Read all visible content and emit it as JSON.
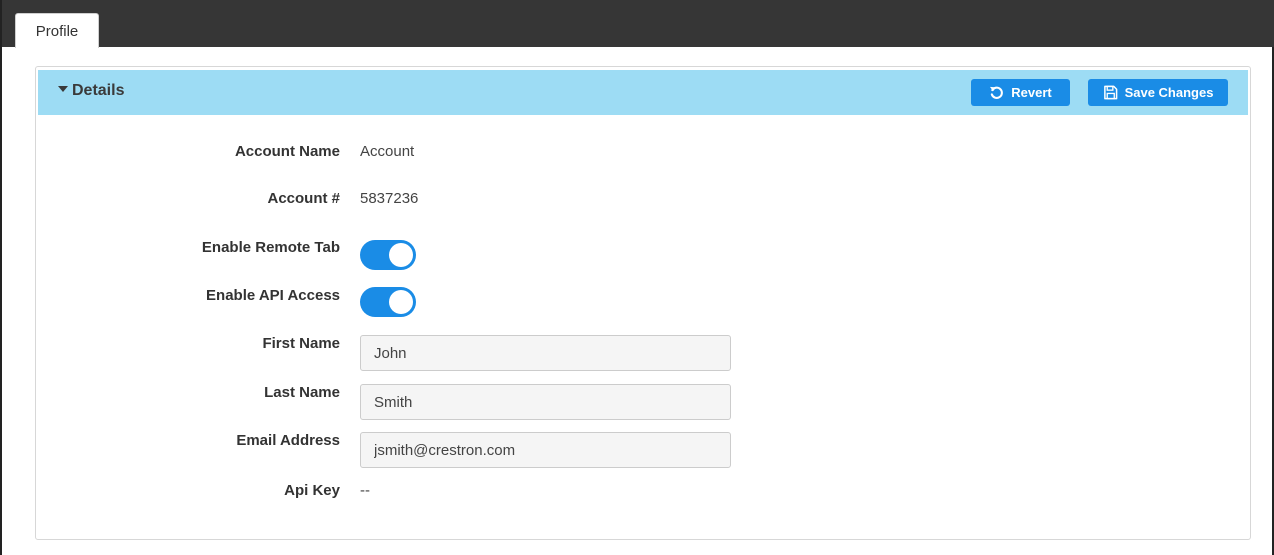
{
  "tabs": [
    {
      "label": "Profile"
    }
  ],
  "panel": {
    "title": "Details",
    "revert_label": "Revert",
    "save_label": "Save Changes"
  },
  "form": {
    "account_name_label": "Account Name",
    "account_name_value": "Account",
    "account_number_label": "Account #",
    "account_number_value": "5837236",
    "remote_tab_label": "Enable Remote Tab",
    "remote_tab_enabled": true,
    "api_access_label": "Enable API Access",
    "api_access_enabled": true,
    "first_name_label": "First Name",
    "first_name_value": "John",
    "last_name_label": "Last Name",
    "last_name_value": "Smith",
    "email_label": "Email Address",
    "email_value": "jsmith@crestron.com",
    "api_key_label": "Api Key",
    "api_key_value": "--"
  },
  "colors": {
    "accent": "#1a8ce6",
    "header_bg": "#9ddcf4",
    "topbar_bg": "#363636"
  },
  "icons": [
    "caret-down-icon",
    "revert-icon",
    "save-icon"
  ]
}
